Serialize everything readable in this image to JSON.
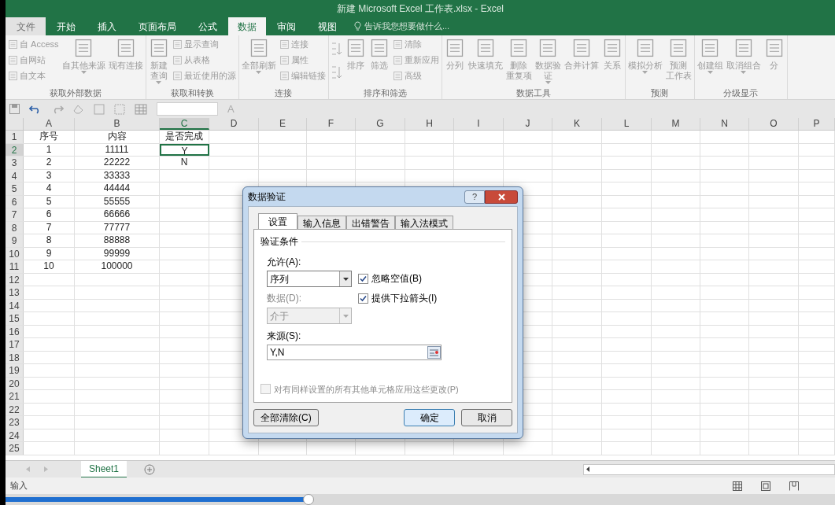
{
  "window": {
    "title": "新建 Microsoft Excel 工作表.xlsx - Excel"
  },
  "tabs": [
    {
      "label": "文件",
      "kind": "file",
      "selected": false
    },
    {
      "label": "开始",
      "kind": "tab",
      "selected": false
    },
    {
      "label": "插入",
      "kind": "tab",
      "selected": false
    },
    {
      "label": "页面布局",
      "kind": "tab",
      "selected": false
    },
    {
      "label": "公式",
      "kind": "tab",
      "selected": false
    },
    {
      "label": "数据",
      "kind": "tab",
      "selected": true
    },
    {
      "label": "审阅",
      "kind": "tab",
      "selected": false
    },
    {
      "label": "视图",
      "kind": "tab",
      "selected": false
    }
  ],
  "tell_me": "告诉我您想要做什么...",
  "ribbon": {
    "groups": [
      {
        "label": "获取外部数据",
        "items": [
          {
            "kind": "stack",
            "items": [
              {
                "label": "自 Access"
              },
              {
                "label": "自网站"
              },
              {
                "label": "自文本"
              }
            ]
          },
          {
            "kind": "large",
            "lines": [
              "自其他来源"
            ],
            "dropdown": true
          },
          {
            "kind": "large",
            "lines": [
              "现有连接"
            ],
            "dropdown": false
          }
        ]
      },
      {
        "label": "获取和转换",
        "items": [
          {
            "kind": "large",
            "lines": [
              "新建",
              "查询"
            ],
            "dropdown": true
          },
          {
            "kind": "stack",
            "items": [
              {
                "label": "显示查询"
              },
              {
                "label": "从表格"
              },
              {
                "label": "最近使用的源"
              }
            ]
          }
        ]
      },
      {
        "label": "连接",
        "items": [
          {
            "kind": "large",
            "lines": [
              "全部刷新"
            ],
            "dropdown": true
          },
          {
            "kind": "stack",
            "items": [
              {
                "label": "连接"
              },
              {
                "label": "属性"
              },
              {
                "label": "编辑链接"
              }
            ]
          }
        ]
      },
      {
        "label": "排序和筛选",
        "items": [
          {
            "kind": "sort"
          },
          {
            "kind": "large",
            "lines": [
              "排序"
            ],
            "dropdown": false
          },
          {
            "kind": "large",
            "lines": [
              "筛选"
            ],
            "dropdown": false
          },
          {
            "kind": "stack",
            "items": [
              {
                "label": "清除"
              },
              {
                "label": "重新应用"
              },
              {
                "label": "高级"
              }
            ]
          }
        ]
      },
      {
        "label": "数据工具",
        "items": [
          {
            "kind": "large",
            "lines": [
              "分列"
            ],
            "dropdown": false
          },
          {
            "kind": "large",
            "lines": [
              "快速填充"
            ],
            "dropdown": false
          },
          {
            "kind": "large",
            "lines": [
              "删除",
              "重复项"
            ],
            "dropdown": false
          },
          {
            "kind": "large",
            "lines": [
              "数据验",
              "证"
            ],
            "dropdown": true
          },
          {
            "kind": "large",
            "lines": [
              "合并计算"
            ],
            "dropdown": false
          },
          {
            "kind": "large",
            "lines": [
              "关系"
            ],
            "dropdown": false
          }
        ]
      },
      {
        "label": "预测",
        "items": [
          {
            "kind": "large",
            "lines": [
              "模拟分析"
            ],
            "dropdown": true
          },
          {
            "kind": "large",
            "lines": [
              "预测",
              "工作表"
            ],
            "dropdown": false
          }
        ]
      },
      {
        "label": "分级显示",
        "items": [
          {
            "kind": "large",
            "lines": [
              "创建组"
            ],
            "dropdown": true
          },
          {
            "kind": "large",
            "lines": [
              "取消组合"
            ],
            "dropdown": true
          },
          {
            "kind": "large",
            "lines": [
              "分"
            ],
            "dropdown": false
          }
        ]
      }
    ]
  },
  "quick_access": {
    "font_button": "A"
  },
  "columns": [
    {
      "label": "A",
      "selected": false
    },
    {
      "label": "B",
      "selected": false
    },
    {
      "label": "C",
      "selected": true
    },
    {
      "label": "D",
      "selected": false
    },
    {
      "label": "E",
      "selected": false
    },
    {
      "label": "F",
      "selected": false
    },
    {
      "label": "G",
      "selected": false
    },
    {
      "label": "H",
      "selected": false
    },
    {
      "label": "I",
      "selected": false
    },
    {
      "label": "J",
      "selected": false
    },
    {
      "label": "K",
      "selected": false
    },
    {
      "label": "L",
      "selected": false
    },
    {
      "label": "M",
      "selected": false
    },
    {
      "label": "N",
      "selected": false
    },
    {
      "label": "O",
      "selected": false
    },
    {
      "label": "P",
      "selected": false
    }
  ],
  "rows": [
    {
      "number": "1",
      "selected": false,
      "cells": [
        {
          "text": "序号",
          "selected": false
        },
        {
          "text": "内容",
          "selected": false
        },
        {
          "text": "是否完成",
          "selected": false
        }
      ]
    },
    {
      "number": "2",
      "selected": true,
      "cells": [
        {
          "text": "1",
          "selected": false
        },
        {
          "text": "11111",
          "selected": false
        },
        {
          "text": "Y",
          "selected": true
        }
      ]
    },
    {
      "number": "3",
      "selected": false,
      "cells": [
        {
          "text": "2",
          "selected": false
        },
        {
          "text": "22222",
          "selected": false
        },
        {
          "text": "N",
          "selected": false
        }
      ]
    },
    {
      "number": "4",
      "selected": false,
      "cells": [
        {
          "text": "3",
          "selected": false
        },
        {
          "text": "33333",
          "selected": false
        }
      ]
    },
    {
      "number": "5",
      "selected": false,
      "cells": [
        {
          "text": "4",
          "selected": false
        },
        {
          "text": "44444",
          "selected": false
        }
      ]
    },
    {
      "number": "6",
      "selected": false,
      "cells": [
        {
          "text": "5",
          "selected": false
        },
        {
          "text": "55555",
          "selected": false
        }
      ]
    },
    {
      "number": "7",
      "selected": false,
      "cells": [
        {
          "text": "6",
          "selected": false
        },
        {
          "text": "66666",
          "selected": false
        }
      ]
    },
    {
      "number": "8",
      "selected": false,
      "cells": [
        {
          "text": "7",
          "selected": false
        },
        {
          "text": "77777",
          "selected": false
        }
      ]
    },
    {
      "number": "9",
      "selected": false,
      "cells": [
        {
          "text": "8",
          "selected": false
        },
        {
          "text": "88888",
          "selected": false
        }
      ]
    },
    {
      "number": "10",
      "selected": false,
      "cells": [
        {
          "text": "9",
          "selected": false
        },
        {
          "text": "99999",
          "selected": false
        }
      ]
    },
    {
      "number": "11",
      "selected": false,
      "cells": [
        {
          "text": "10",
          "selected": false
        },
        {
          "text": "100000",
          "selected": false
        }
      ]
    },
    {
      "number": "12",
      "selected": false,
      "cells": []
    },
    {
      "number": "13",
      "selected": false,
      "cells": []
    },
    {
      "number": "14",
      "selected": false,
      "cells": []
    },
    {
      "number": "15",
      "selected": false,
      "cells": []
    },
    {
      "number": "16",
      "selected": false,
      "cells": []
    },
    {
      "number": "17",
      "selected": false,
      "cells": []
    },
    {
      "number": "18",
      "selected": false,
      "cells": []
    },
    {
      "number": "19",
      "selected": false,
      "cells": []
    },
    {
      "number": "20",
      "selected": false,
      "cells": []
    },
    {
      "number": "21",
      "selected": false,
      "cells": []
    },
    {
      "number": "22",
      "selected": false,
      "cells": []
    },
    {
      "number": "23",
      "selected": false,
      "cells": []
    },
    {
      "number": "24",
      "selected": false,
      "cells": []
    },
    {
      "number": "25",
      "selected": false,
      "cells": []
    }
  ],
  "dialog": {
    "title": "数据验证",
    "help": "?",
    "tabs": [
      {
        "label": "设置",
        "selected": true
      },
      {
        "label": "输入信息",
        "selected": false
      },
      {
        "label": "出错警告",
        "selected": false
      },
      {
        "label": "输入法模式",
        "selected": false
      }
    ],
    "section": "验证条件",
    "allow_label": "允许(A):",
    "allow_value": "序列",
    "ignore_blank": {
      "label": "忽略空值(B)",
      "checked": true
    },
    "in_cell_dropdown": {
      "label": "提供下拉箭头(I)",
      "checked": true
    },
    "data_label": "数据(D):",
    "data_value": "介于",
    "source_label": "来源(S):",
    "source_value": "Y,N",
    "apply_all": {
      "label": "对有同样设置的所有其他单元格应用这些更改(P)",
      "checked": false
    },
    "buttons": [
      {
        "label": "全部清除(C)",
        "kind": "left"
      },
      {
        "label": "确定",
        "kind": "default"
      },
      {
        "label": "取消",
        "kind": "normal"
      }
    ]
  },
  "sheets": [
    {
      "label": "Sheet1",
      "selected": true
    }
  ],
  "status_bar": {
    "mode": "输入"
  },
  "video_progress": {
    "level": 0.365
  }
}
